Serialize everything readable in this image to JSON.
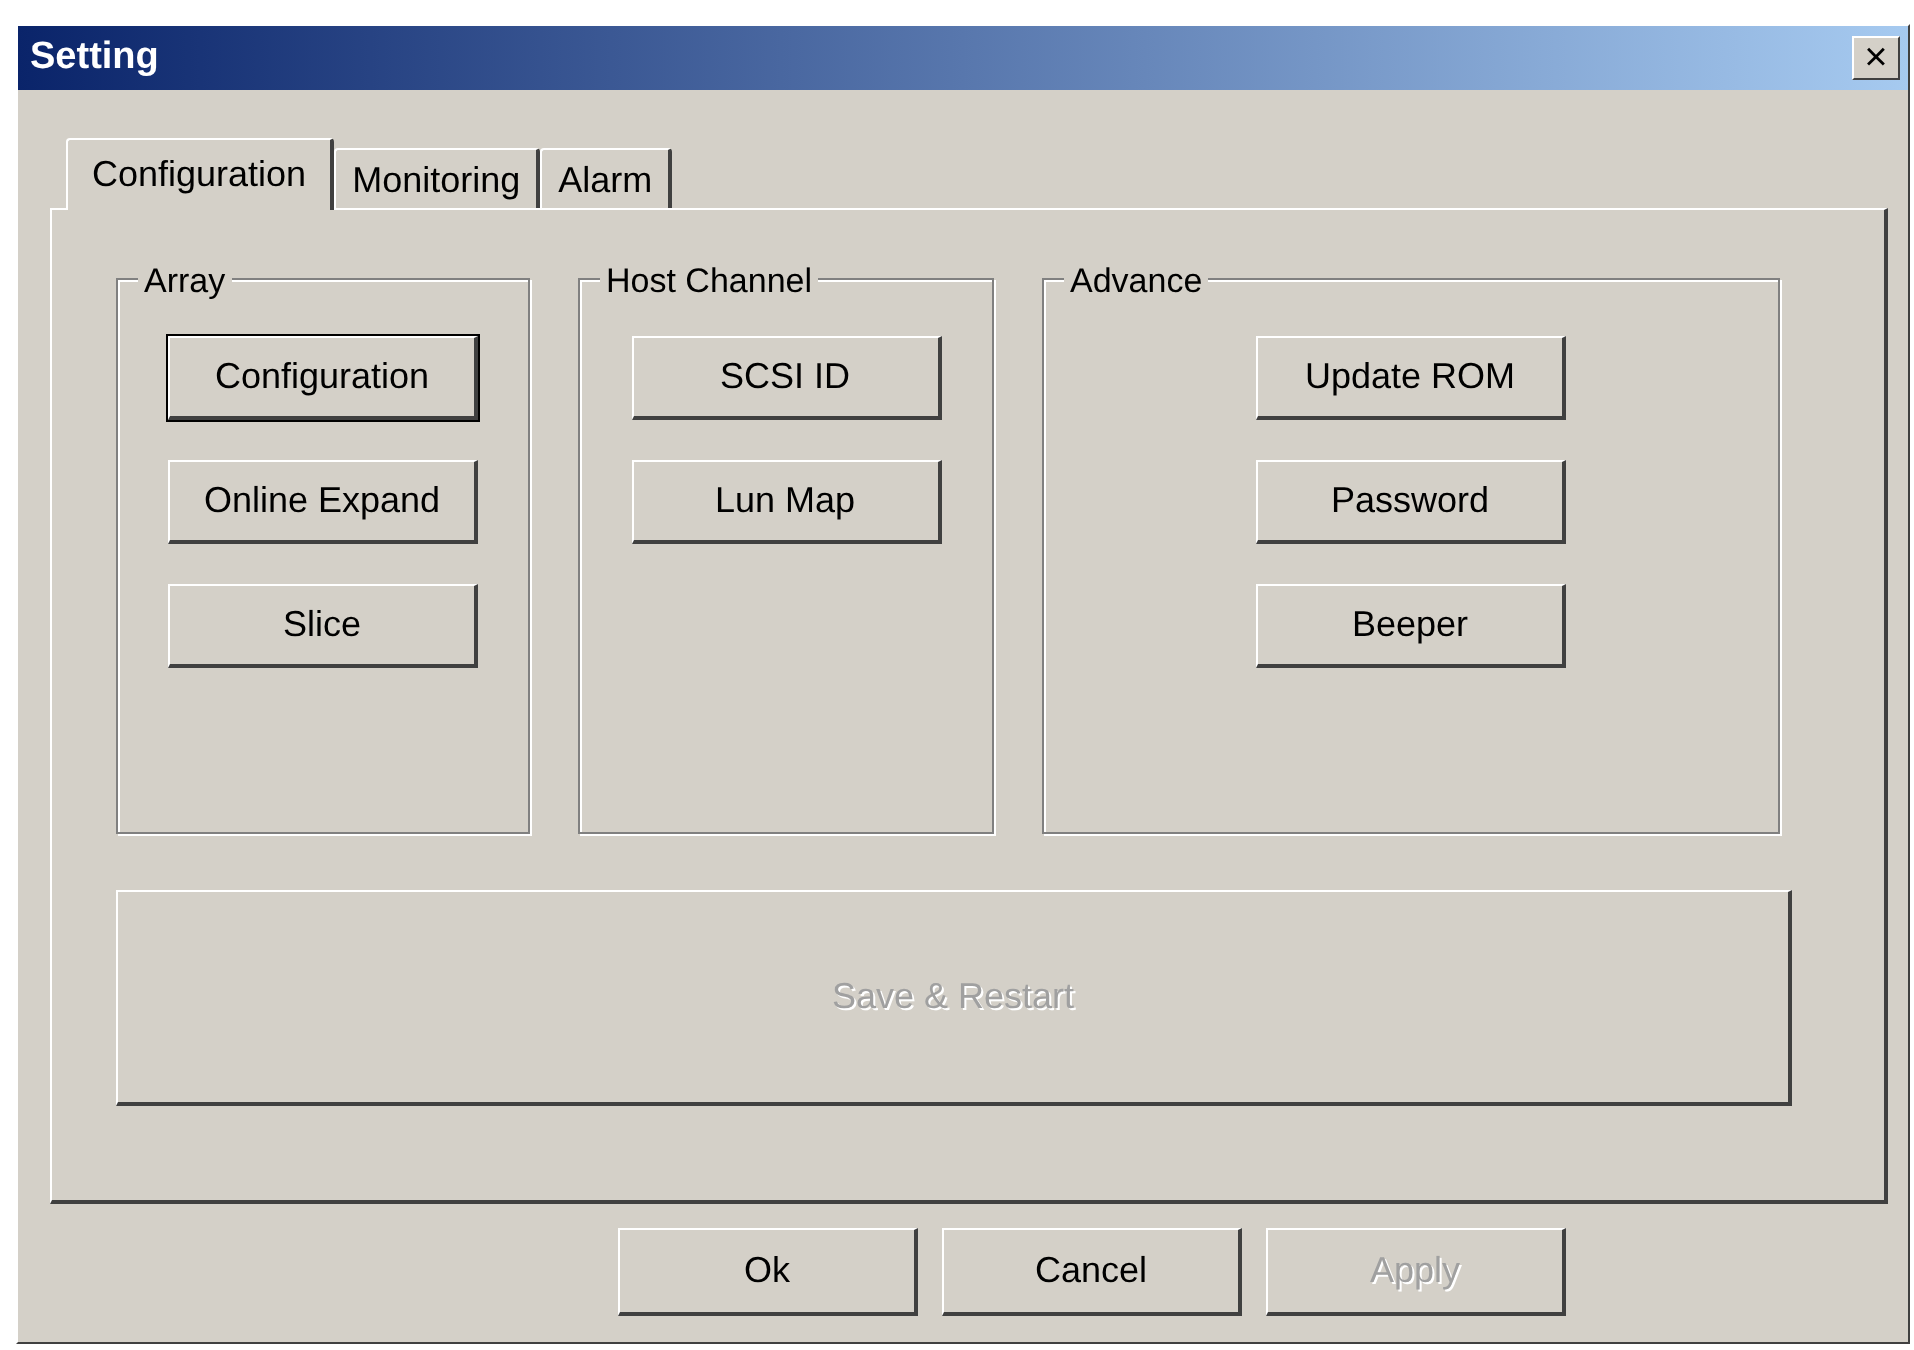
{
  "window": {
    "title": "Setting",
    "close": "×"
  },
  "tabs": [
    {
      "label": "Configuration",
      "selected": true
    },
    {
      "label": "Monitoring",
      "selected": false
    },
    {
      "label": "Alarm",
      "selected": false
    }
  ],
  "groups": [
    {
      "title": "Array",
      "buttons": [
        {
          "label": "Configuration",
          "disabled": false,
          "focused": true
        },
        {
          "label": "Online Expand",
          "disabled": false,
          "focused": false
        },
        {
          "label": "Slice",
          "disabled": false,
          "focused": false
        }
      ]
    },
    {
      "title": "Host Channel",
      "buttons": [
        {
          "label": "SCSI ID",
          "disabled": false,
          "focused": false
        },
        {
          "label": "Lun Map",
          "disabled": false,
          "focused": false
        }
      ]
    },
    {
      "title": "Advance",
      "buttons": [
        {
          "label": "Update ROM",
          "disabled": false,
          "focused": false
        },
        {
          "label": "Password",
          "disabled": false,
          "focused": false
        },
        {
          "label": "Beeper",
          "disabled": false,
          "focused": false
        }
      ]
    }
  ],
  "save_button": {
    "label": "Save & Restart",
    "disabled": true
  },
  "footer_buttons": [
    {
      "label": "Ok",
      "disabled": false
    },
    {
      "label": "Cancel",
      "disabled": false
    },
    {
      "label": "Apply",
      "disabled": true
    }
  ]
}
